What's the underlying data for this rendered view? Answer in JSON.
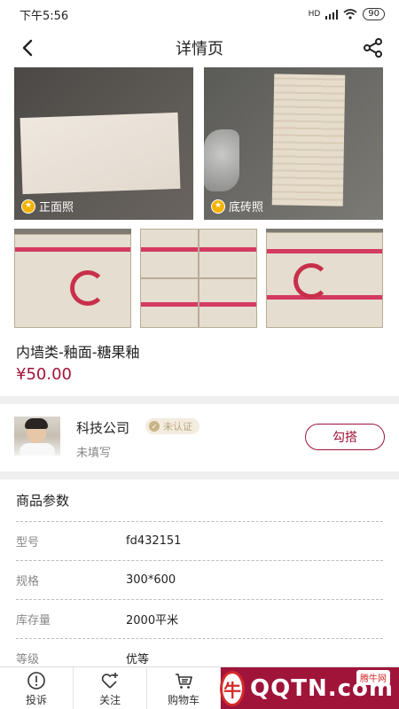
{
  "status_bar": {
    "time": "下午5:56",
    "network": "HD",
    "battery": "90"
  },
  "header": {
    "title": "详情页"
  },
  "gallery": {
    "front_label": "正面照",
    "back_label": "底砖照"
  },
  "product": {
    "name": "内墙类-釉面-糖果釉",
    "price": "¥50.00"
  },
  "seller": {
    "name": "科技公司",
    "verify_status": "未认证",
    "subtitle": "未填写",
    "contact_label": "勾搭"
  },
  "params": {
    "title": "商品参数",
    "rows": [
      {
        "key": "型号",
        "value": "fd432151"
      },
      {
        "key": "规格",
        "value": "300*600"
      },
      {
        "key": "库存量",
        "value": "2000平米"
      },
      {
        "key": "等级",
        "value": "优等"
      }
    ]
  },
  "bottom_bar": {
    "complain": "投诉",
    "follow": "关注",
    "cart": "购物车"
  },
  "watermark": {
    "brand": "QQTN.com",
    "badge": "腾牛网",
    "logo_char": "牛"
  },
  "colors": {
    "accent": "#a0143a",
    "star": "#f4b400",
    "verify_bg": "#f3ecdf"
  }
}
